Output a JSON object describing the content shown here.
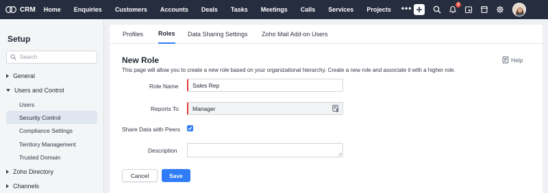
{
  "app": {
    "logo_text": "CRM"
  },
  "nav": {
    "items": [
      "Home",
      "Enquiries",
      "Customers",
      "Accounts",
      "Deals",
      "Tasks",
      "Meetings",
      "Calls",
      "Services",
      "Projects"
    ],
    "more": "•••",
    "notification_count": "2"
  },
  "sidebar": {
    "title": "Setup",
    "search_placeholder": "Search",
    "sections": {
      "general": "General",
      "users_and_control": "Users and Control",
      "zoho_directory": "Zoho Directory",
      "channels": "Channels"
    },
    "items": [
      "Users",
      "Security Control",
      "Compliance Settings",
      "Territory Management",
      "Trusted Domain"
    ],
    "active_item": "Security Control"
  },
  "tabs": [
    "Profiles",
    "Roles",
    "Data Sharing Settings",
    "Zoho Mail Add-on Users"
  ],
  "active_tab": "Roles",
  "page": {
    "title": "New Role",
    "description": "This page will allow you to create a new role based on your organizational hierarchy. Create a new role and associate it with a higher role.",
    "help_label": "Help"
  },
  "form": {
    "role_name_label": "Role Name",
    "role_name_value": "Sales Rep",
    "reports_to_label": "Reports To",
    "reports_to_value": "Manager",
    "share_data_label": "Share Data with Peers",
    "share_data_checked": true,
    "description_label": "Description",
    "description_value": ""
  },
  "buttons": {
    "cancel": "Cancel",
    "save": "Save"
  },
  "colors": {
    "topbar": "#262d3e",
    "accent": "#2f7cf6",
    "required": "#e53935",
    "badge": "#e74c3c"
  }
}
